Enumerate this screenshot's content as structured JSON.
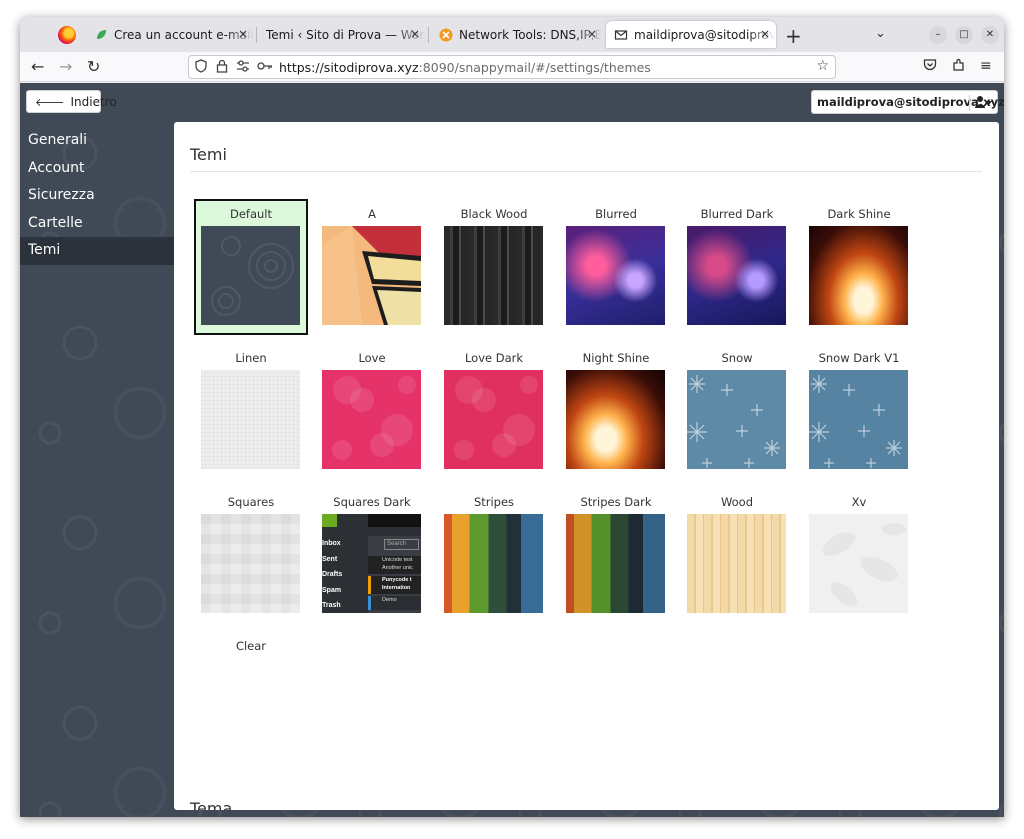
{
  "browser": {
    "tabs": [
      {
        "label": "Crea un account e-mail - ("
      },
      {
        "label": "Temi ‹ Sito di Prova — WordP"
      },
      {
        "label": "Network Tools: DNS,IP,Em"
      },
      {
        "label": "maildiprova@sitodiprova."
      }
    ],
    "tab_close": "×",
    "new_tab": "+",
    "tab_list": "⌄",
    "url_host": "https://sitodiprova.xyz",
    "url_rest": ":8090/snappymail/#/settings/themes"
  },
  "app": {
    "back_label": "Indietro",
    "user_email": "maildiprova@sitodiprova.xyz",
    "sidebar": [
      {
        "label": "Generali",
        "active": false
      },
      {
        "label": "Account",
        "active": false
      },
      {
        "label": "Sicurezza",
        "active": false
      },
      {
        "label": "Cartelle",
        "active": false
      },
      {
        "label": "Temi",
        "active": true
      }
    ],
    "section_title": "Temi",
    "bottom_section_title": "Tema",
    "themes": [
      {
        "name": "Default",
        "selected": true,
        "style": "default"
      },
      {
        "name": "A",
        "selected": false,
        "style": "a"
      },
      {
        "name": "Black Wood",
        "selected": false,
        "style": "blackwood"
      },
      {
        "name": "Blurred",
        "selected": false,
        "style": "blurred"
      },
      {
        "name": "Blurred Dark",
        "selected": false,
        "style": "blurreddark"
      },
      {
        "name": "Dark Shine",
        "selected": false,
        "style": "darkshine"
      },
      {
        "name": "Linen",
        "selected": false,
        "style": "linen"
      },
      {
        "name": "Love",
        "selected": false,
        "style": "love"
      },
      {
        "name": "Love Dark",
        "selected": false,
        "style": "lovedark"
      },
      {
        "name": "Night Shine",
        "selected": false,
        "style": "nightshine"
      },
      {
        "name": "Snow",
        "selected": false,
        "style": "snow"
      },
      {
        "name": "Snow Dark V1",
        "selected": false,
        "style": "snowdark"
      },
      {
        "name": "Squares",
        "selected": false,
        "style": "squares"
      },
      {
        "name": "Squares Dark",
        "selected": false,
        "style": "squaresdark"
      },
      {
        "name": "Stripes",
        "selected": false,
        "style": "stripes"
      },
      {
        "name": "Stripes Dark",
        "selected": false,
        "style": "stripesdark"
      },
      {
        "name": "Wood",
        "selected": false,
        "style": "wood"
      },
      {
        "name": "Xv",
        "selected": false,
        "style": "xv"
      },
      {
        "name": "Clear",
        "selected": false,
        "style": "clear"
      }
    ],
    "preview_folders": [
      "Inbox",
      "Sent",
      "Drafts",
      "Spam",
      "Trash"
    ],
    "preview_search": "Search",
    "preview_messages": [
      "Unicode test",
      "Another unic",
      "Punycode t",
      "Internation",
      "Demo"
    ]
  },
  "colors": {
    "app_background": "#404a56",
    "sidebar_active": "#2b323b",
    "selected_theme_bg": "#dcf9dc"
  }
}
